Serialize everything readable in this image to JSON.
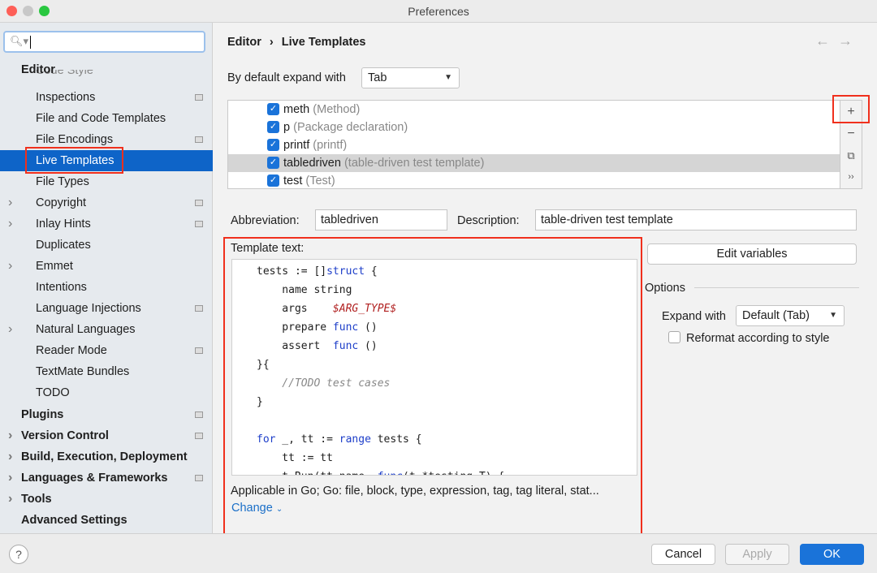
{
  "window": {
    "title": "Preferences"
  },
  "sidebar": {
    "search_placeholder": "",
    "items": [
      {
        "label": "Editor",
        "bold": true
      },
      {
        "label": "Code Style",
        "partial": true
      },
      {
        "label": "Inspections",
        "badge": true
      },
      {
        "label": "File and Code Templates"
      },
      {
        "label": "File Encodings",
        "badge": true
      },
      {
        "label": "Live Templates",
        "selected": true
      },
      {
        "label": "File Types"
      },
      {
        "label": "Copyright",
        "arrow": true,
        "badge": true
      },
      {
        "label": "Inlay Hints",
        "arrow": true,
        "badge": true
      },
      {
        "label": "Duplicates"
      },
      {
        "label": "Emmet",
        "arrow": true
      },
      {
        "label": "Intentions"
      },
      {
        "label": "Language Injections",
        "badge": true
      },
      {
        "label": "Natural Languages",
        "arrow": true
      },
      {
        "label": "Reader Mode",
        "badge": true
      },
      {
        "label": "TextMate Bundles"
      },
      {
        "label": "TODO"
      },
      {
        "label": "Plugins",
        "bold": true,
        "badge": true
      },
      {
        "label": "Version Control",
        "bold": true,
        "arrow": true,
        "badge": true
      },
      {
        "label": "Build, Execution, Deployment",
        "bold": true,
        "arrow": true
      },
      {
        "label": "Languages & Frameworks",
        "bold": true,
        "arrow": true,
        "badge": true
      },
      {
        "label": "Tools",
        "bold": true,
        "arrow": true
      },
      {
        "label": "Advanced Settings",
        "bold": true
      }
    ]
  },
  "breadcrumb": {
    "parent": "Editor",
    "sep": "›",
    "current": "Live Templates"
  },
  "expand": {
    "label": "By default expand with",
    "value": "Tab"
  },
  "templates": [
    {
      "abbr": "meth",
      "desc": "(Method)"
    },
    {
      "abbr": "p",
      "desc": "(Package declaration)"
    },
    {
      "abbr": "printf",
      "desc": "(printf)"
    },
    {
      "abbr": "tabledriven",
      "desc": "(table-driven test template)",
      "selected": true
    },
    {
      "abbr": "test",
      "desc": "(Test)"
    }
  ],
  "tools": {
    "add": "+",
    "remove": "−",
    "copy": "⧉",
    "more": "››"
  },
  "form": {
    "abbr_label": "Abbreviation:",
    "abbr_value": "tabledriven",
    "desc_label": "Description:",
    "desc_value": "table-driven test template",
    "template_text_label": "Template text:",
    "edit_variables": "Edit variables"
  },
  "code": [
    [
      [
        "t",
        "tests := []"
      ],
      [
        "kw",
        "struct"
      ],
      [
        "t",
        " {"
      ]
    ],
    [
      [
        "t",
        "    name string"
      ]
    ],
    [
      [
        "t",
        "    args    "
      ],
      [
        "var",
        "$ARG_TYPE$"
      ]
    ],
    [
      [
        "t",
        "    prepare "
      ],
      [
        "kw",
        "func"
      ],
      [
        "t",
        " ()"
      ]
    ],
    [
      [
        "t",
        "    assert  "
      ],
      [
        "kw",
        "func"
      ],
      [
        "t",
        " ()"
      ]
    ],
    [
      [
        "t",
        "}{"
      ]
    ],
    [
      [
        "cm",
        "    //TODO test cases"
      ]
    ],
    [
      [
        "t",
        "}"
      ]
    ],
    [
      [
        "t",
        ""
      ]
    ],
    [
      [
        "kw",
        "for"
      ],
      [
        "t",
        " _, tt := "
      ],
      [
        "kw",
        "range"
      ],
      [
        "t",
        " tests {"
      ]
    ],
    [
      [
        "t",
        "    tt := tt"
      ]
    ],
    [
      [
        "t",
        "    t.Run(tt.name, "
      ],
      [
        "kw",
        "func"
      ],
      [
        "t",
        "(t *testing.T) {"
      ]
    ]
  ],
  "applicable": {
    "text": "Applicable in Go; Go: file, block, type, expression, tag, tag literal, stat...",
    "change": "Change"
  },
  "options": {
    "title": "Options",
    "expand_label": "Expand with",
    "expand_value": "Default (Tab)",
    "reformat_label": "Reformat according to style",
    "reformat_checked": false
  },
  "footer": {
    "help": "?",
    "cancel": "Cancel",
    "apply": "Apply",
    "ok": "OK"
  },
  "colors": {
    "accent": "#0e64c8",
    "highlight": "#f0301d"
  }
}
